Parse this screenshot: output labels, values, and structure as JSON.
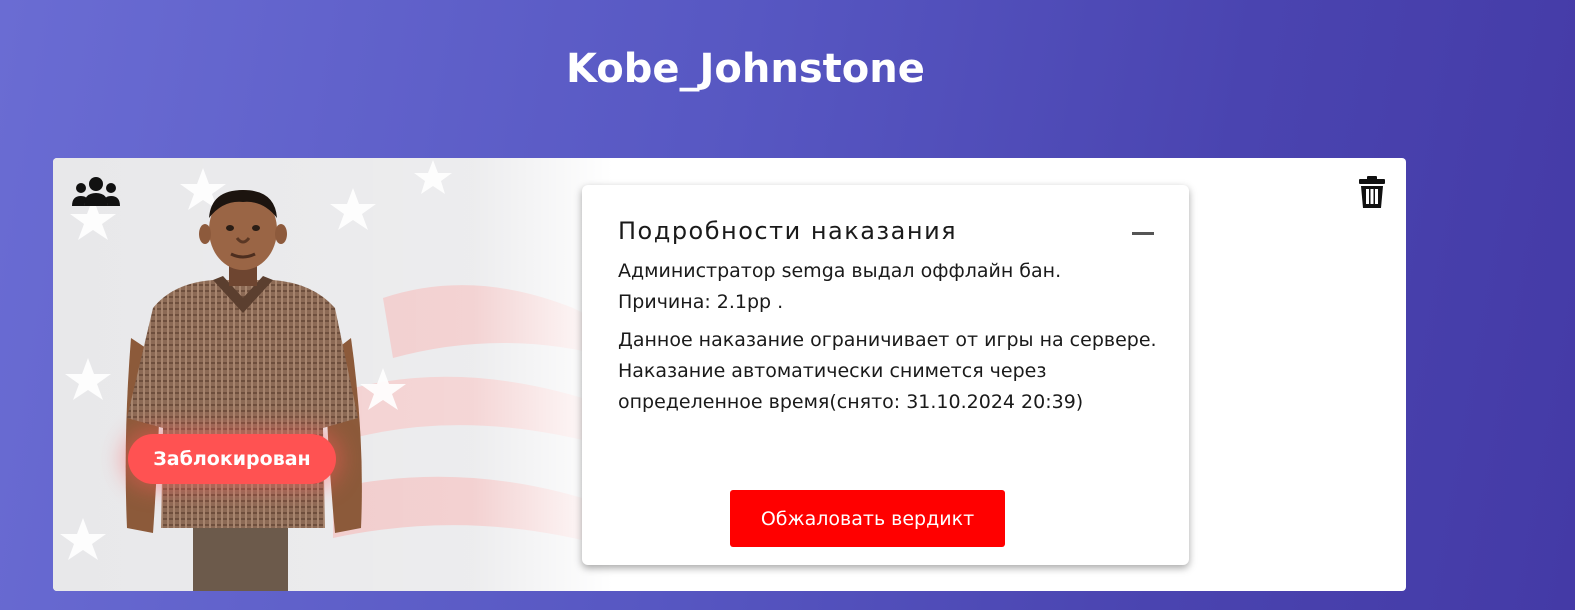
{
  "page": {
    "player_name": "Kobe_Johnstone"
  },
  "card": {
    "status_badge": "Заблокирован",
    "details": {
      "title": "Подробности наказания",
      "admin_line": "Администратор semga выдал оффлайн бан.",
      "reason_line": "Причина: 2.1рр .",
      "description": "Данное наказание ограничивает от игры на сервере. Наказание автоматически снимется через определенное время(снято: 31.10.2024 20:39)",
      "appeal_button": "Обжаловать вердикт"
    }
  },
  "icons": {
    "group": "users-group-icon",
    "delete": "trash-icon",
    "collapse": "minus-icon"
  },
  "colors": {
    "background_start": "#6a6cd3",
    "background_end": "#443aa6",
    "badge": "#ff5252",
    "appeal_button": "#ff0000"
  }
}
